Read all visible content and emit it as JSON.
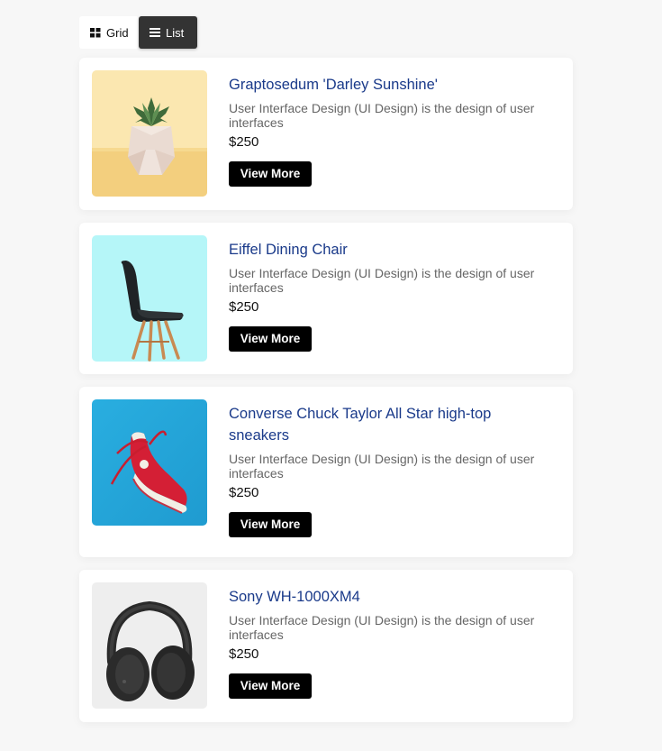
{
  "view_toggle": {
    "grid_label": "Grid",
    "list_label": "List",
    "active": "list"
  },
  "products": [
    {
      "title": "Graptosedum 'Darley Sunshine'",
      "description": "User Interface Design (UI Design) is the design of user interfaces",
      "price": "$250",
      "button": "View More",
      "image_icon": "succulent-plant-image"
    },
    {
      "title": "Eiffel Dining Chair",
      "description": "User Interface Design (UI Design) is the design of user interfaces",
      "price": "$250",
      "button": "View More",
      "image_icon": "chair-image"
    },
    {
      "title": "Converse Chuck Taylor All Star high-top sneakers",
      "description": "User Interface Design (UI Design) is the design of user interfaces",
      "price": "$250",
      "button": "View More",
      "image_icon": "sneaker-image"
    },
    {
      "title": "Sony WH-1000XM4",
      "description": "User Interface Design (UI Design) is the design of user interfaces",
      "price": "$250",
      "button": "View More",
      "image_icon": "headphones-image"
    }
  ]
}
